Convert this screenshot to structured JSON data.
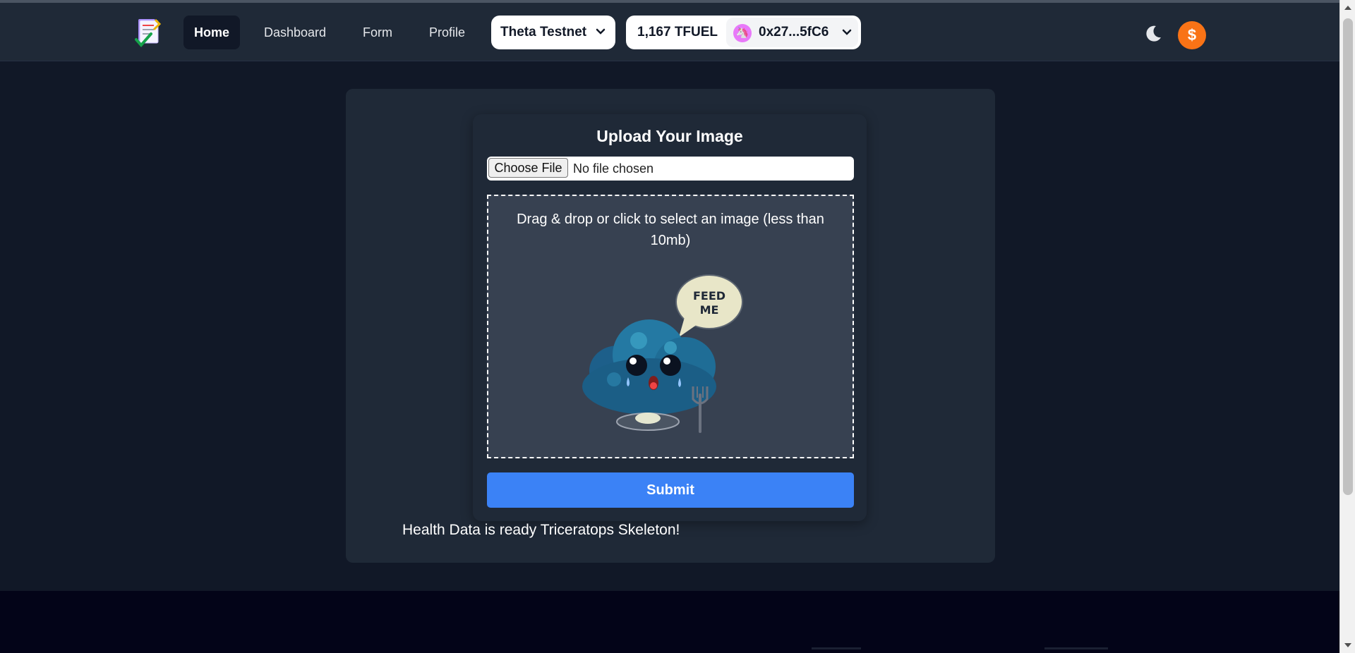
{
  "nav": {
    "links": [
      {
        "label": "Home",
        "active": true
      },
      {
        "label": "Dashboard",
        "active": false
      },
      {
        "label": "Form",
        "active": false
      },
      {
        "label": "Profile",
        "active": false
      }
    ],
    "network": "Theta Testnet",
    "balance": "1,167 TFUEL",
    "address": "0x27...5fC6",
    "coin_symbol": "$",
    "icons": [
      "logo-icon",
      "chevron-down-icon",
      "account-avatar-icon",
      "moon-icon",
      "coin-icon"
    ]
  },
  "form": {
    "title": "Upload Your Image",
    "choose_file_label": "Choose File",
    "no_file_text": "No file chosen",
    "dropzone_text": "Drag & drop or click to select an image (less than 10mb)",
    "illustration_text_1": "FEED",
    "illustration_text_2": "ME",
    "submit_label": "Submit"
  },
  "status_message": "Health Data is ready Triceratops Skeleton!",
  "colors": {
    "background": "#111827",
    "navbar": "#1f2937",
    "card": "#1f2937",
    "dropzone": "#374151",
    "accent": "#3b82f6",
    "coin": "#f97316",
    "footer": "#030418"
  }
}
